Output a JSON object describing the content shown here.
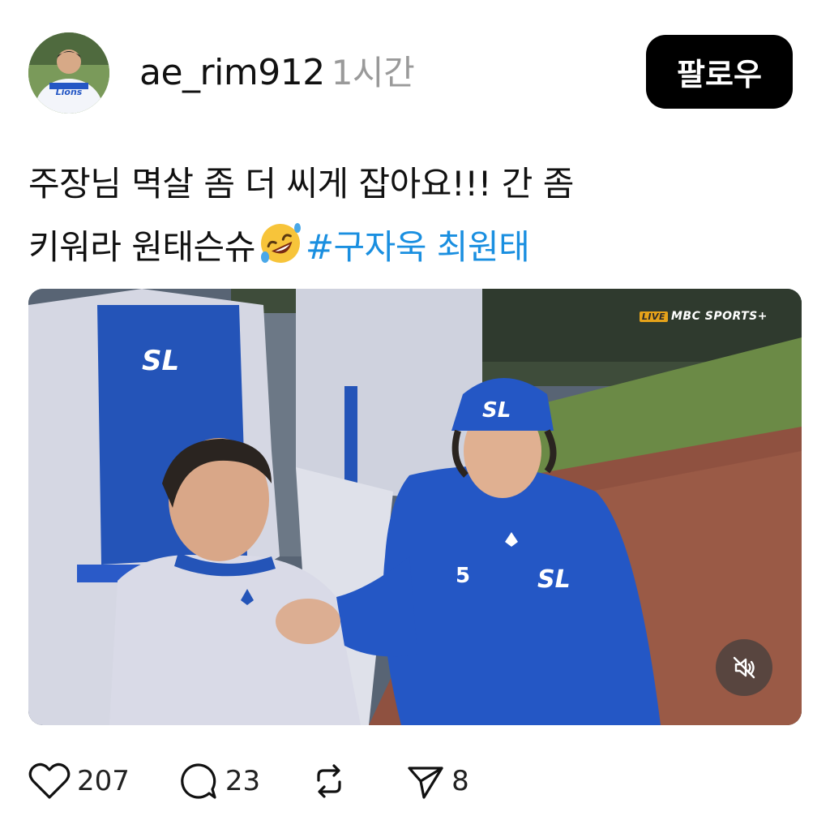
{
  "header": {
    "username": "ae_rim912",
    "time": "1시간",
    "follow_label": "팔로우"
  },
  "post": {
    "line1": "주장님 멱살 좀 더 씨게 잡아요!!! 간 좀",
    "line2_text": "키워라 원태슨슈",
    "emoji": "rolling-on-floor-laughing-emoji",
    "hashtag": "#구자욱 최원태"
  },
  "media": {
    "broadcast_live": "LIVE",
    "broadcast_name": "MBC SPORTS+",
    "jersey_number": "5",
    "mute_icon": "speaker-muted-icon"
  },
  "actions": {
    "likes": "207",
    "comments": "23",
    "shares": "8"
  },
  "colors": {
    "hashtag": "#1a8fe0",
    "follow_bg": "#000000",
    "team_blue": "#2457c5"
  }
}
